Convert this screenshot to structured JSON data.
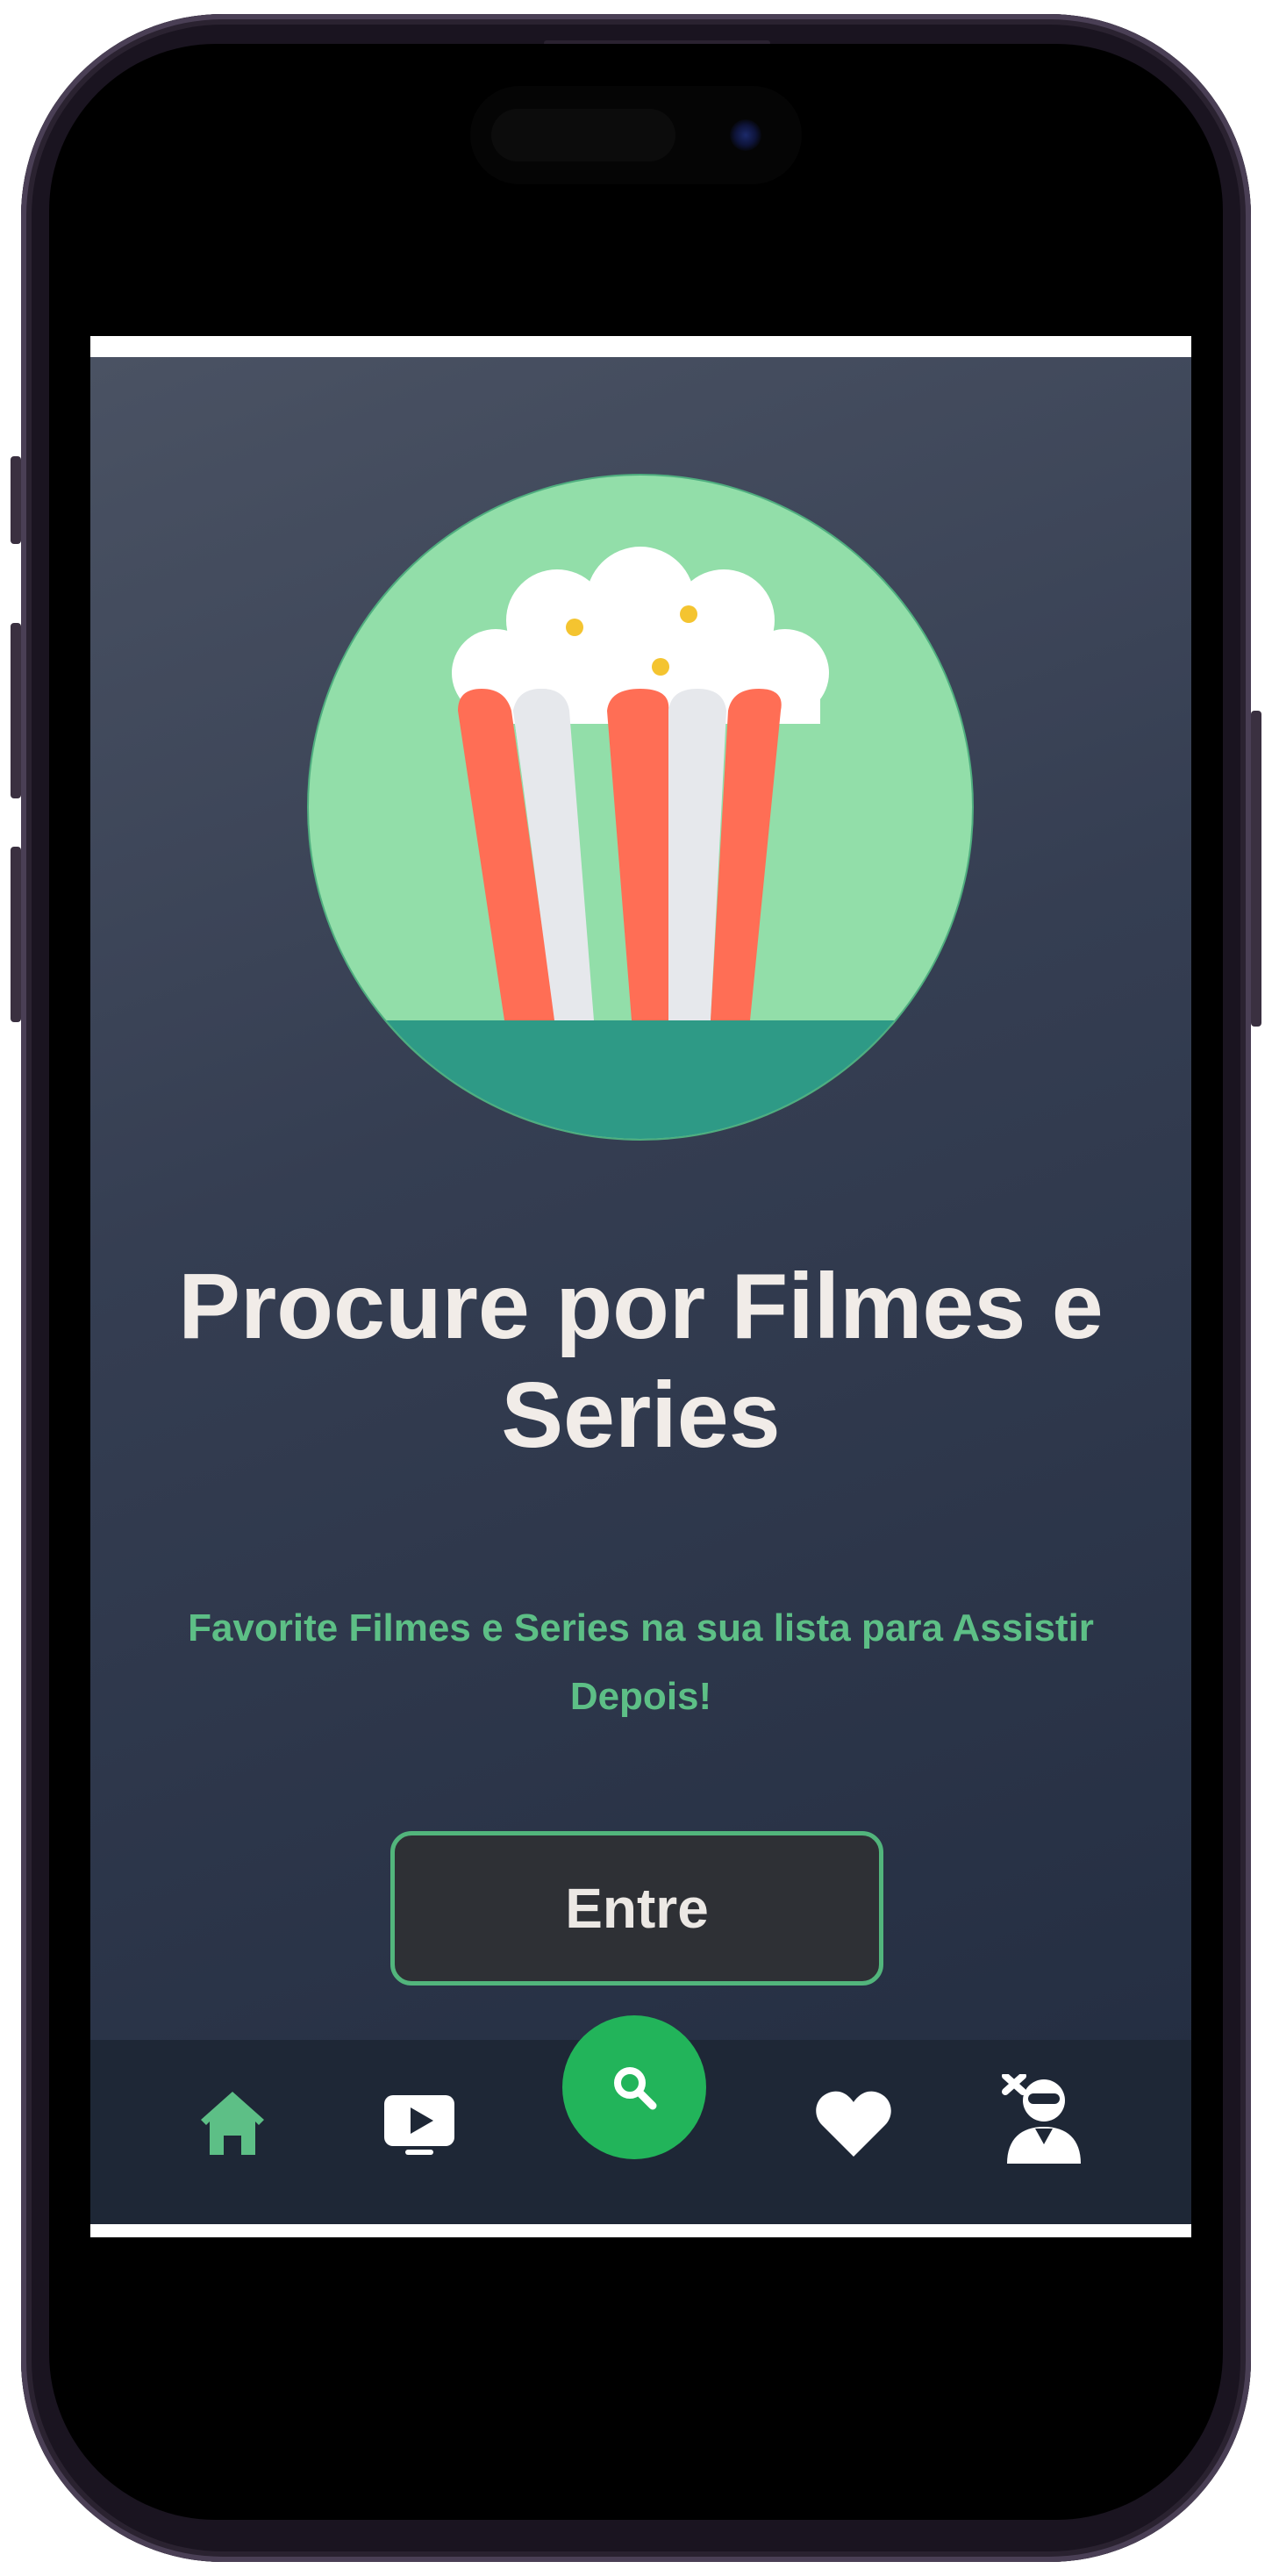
{
  "hero": {
    "title": "Procure por Filmes e Series",
    "subtitle": "Favorite Filmes e Series na sua lista para Assistir Depois!",
    "logo_icon": "popcorn-icon"
  },
  "actions": {
    "enter_label": "Entre"
  },
  "bottom_nav": {
    "items": [
      {
        "icon": "home-icon",
        "active": true
      },
      {
        "icon": "tv-play-icon",
        "active": false
      },
      {
        "icon": "search-icon",
        "active": false
      },
      {
        "icon": "heart-icon",
        "active": false
      },
      {
        "icon": "user-ninja-icon",
        "active": false
      }
    ]
  },
  "colors": {
    "accent_green": "#5dbf86",
    "search_button": "#22b45a",
    "background_dark": "#222c40",
    "nav_background": "#1e2736"
  }
}
